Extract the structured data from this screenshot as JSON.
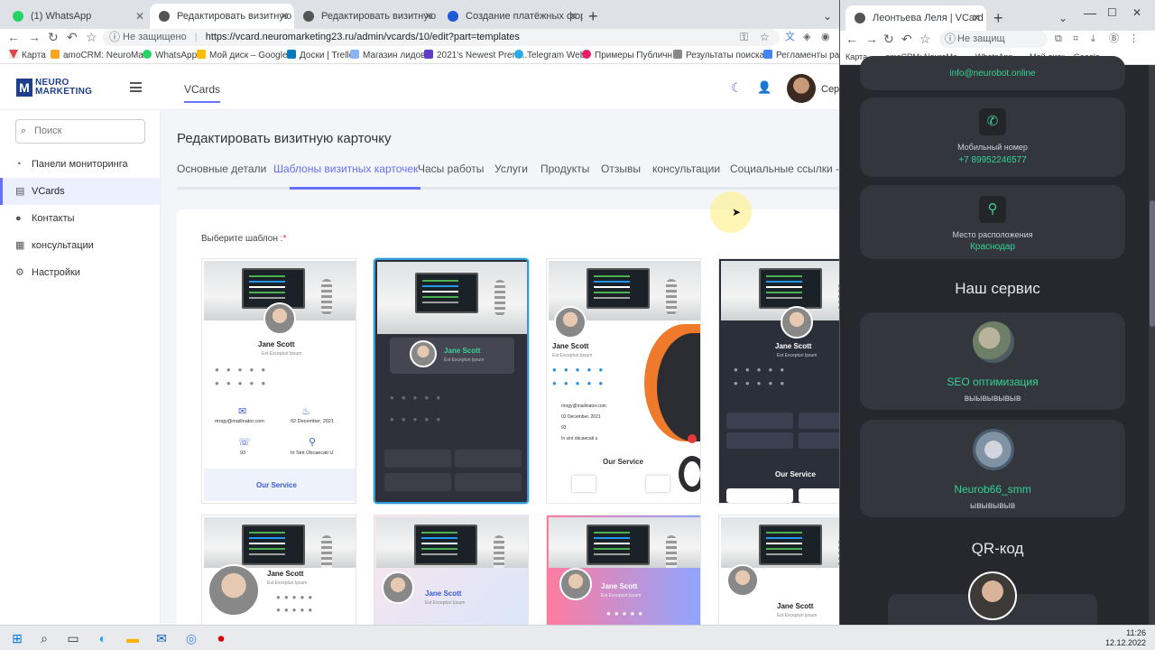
{
  "left_browser": {
    "tabs": [
      {
        "title": "(1) WhatsApp",
        "active": false,
        "color": "#25d366"
      },
      {
        "title": "Редактировать визитную карто",
        "active": true,
        "color": "#555"
      },
      {
        "title": "Редактировать визитную карто",
        "active": false,
        "color": "#555"
      },
      {
        "title": "Создание платёжных форм ЮК",
        "active": false,
        "color": "#1e5bd6"
      }
    ],
    "address": {
      "security": "Не защищено",
      "url": "https://vcard.neuromarketing23.ru/admin/vcards/10/edit?part=templates"
    },
    "bookmarks": [
      "Карта",
      "amoCRM: NeuroMa...",
      "WhatsApp",
      "Мой диск – Google...",
      "Доски | Trello",
      "Магазин лидов",
      "2021's Newest Prem...",
      "Telegram Web",
      "Примеры Публичн...",
      "Результаты поиска...",
      "Регламенты работ"
    ]
  },
  "app": {
    "logo": {
      "line1": "NEURO",
      "line2": "MARKETING",
      "mark": "M"
    },
    "top_nav": "VCards",
    "user_name": "Сер",
    "search_placeholder": "Поиск",
    "sidebar": [
      {
        "label": "Панели мониторинга",
        "icon": "dashboard-icon",
        "active": false
      },
      {
        "label": "VCards",
        "icon": "vcard-icon",
        "active": true
      },
      {
        "label": "Контакты",
        "icon": "contacts-icon",
        "active": false
      },
      {
        "label": "консультации",
        "icon": "calendar-icon",
        "active": false
      },
      {
        "label": "Настройки",
        "icon": "gear-icon",
        "active": false
      }
    ],
    "page_title": "Редактировать визитную карточку",
    "tabs": [
      "Основные детали",
      "Шаблоны визитных карточек",
      "Часы работы",
      "Услуги",
      "Продукты",
      "Отзывы",
      "консультации",
      "Социальные ссылки - Б"
    ],
    "active_tab": "Шаблоны визитных карточек",
    "choose_label": "Выберите шаблон :",
    "required_mark": "*",
    "templates": [
      {
        "name": "Jane Scott",
        "sub": "Est Excepturi Ipsum",
        "email": "rirogy@mailinator.com",
        "date": "02 December, 2021",
        "num": "93",
        "loc": "In Sint Obcaecati U",
        "service": "Our Service"
      },
      {
        "name": "Jane Scott",
        "sub": "Est Excepturi Ipsum",
        "selected": true
      },
      {
        "name": "Jane Scott",
        "sub": "Est Excepturi Ipsum",
        "email": "rirogy@mailinator.com",
        "date": "02 December, 2021",
        "num": "93",
        "loc": "In sint obcaecati u",
        "service": "Our Service"
      },
      {
        "name": "Jane Scott",
        "sub": "Est Excepturi Ipsum",
        "service": "Our Service"
      },
      {
        "name": "Jane Scott",
        "sub": "Est Excepturi Ipsum"
      },
      {
        "name": "Jane Scott",
        "sub": "Est Excepturi Ipsum"
      },
      {
        "name": "Jane Scott",
        "sub": "Est Excepturi Ipsum"
      },
      {
        "name": "Jane Scott",
        "sub": "Est Excepturi Ipsum"
      }
    ]
  },
  "right_browser": {
    "tab_title": "Леонтьева Леля | VCard Neuro",
    "address": {
      "security": "Не защищ"
    },
    "bookmarks": [
      "Карта",
      "amoCRM: NeuroMa...",
      "WhatsApp",
      "Мой диск – Google..."
    ],
    "email_value": "info@neurobot.online",
    "phone_label": "Мобильный номер",
    "phone_value": "+7 89952246577",
    "location_label": "Место расположения",
    "location_value": "Краснодар",
    "services_heading": "Наш сервис",
    "services": [
      {
        "title": "SEO оптимизация",
        "desc": "выывывывыв"
      },
      {
        "title": "Neurob66_smm",
        "desc": "ывывывыв"
      }
    ],
    "qr_heading": "QR-код"
  },
  "taskbar": {
    "time": "11:26",
    "date": "12.12.2022"
  },
  "colors": {
    "accent": "#6571ff",
    "green": "#34d399",
    "dark_card": "#33363d"
  }
}
